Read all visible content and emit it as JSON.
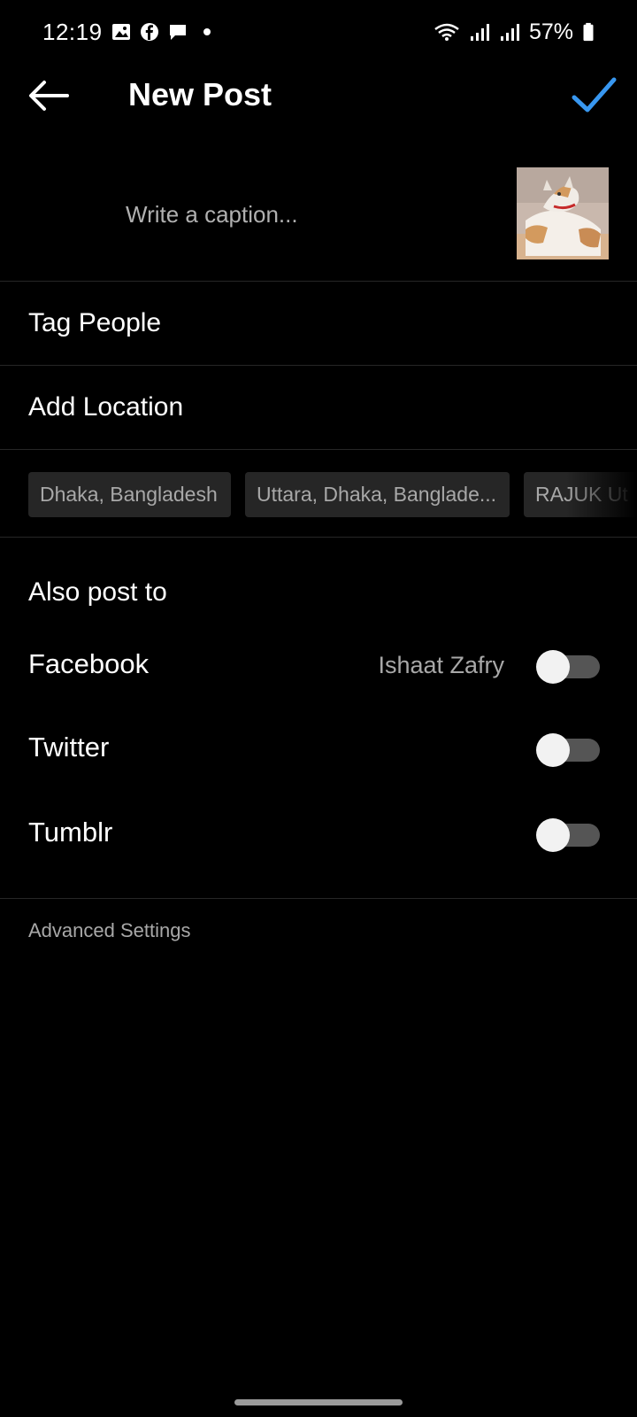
{
  "status_bar": {
    "time": "12:19",
    "battery": "57%"
  },
  "header": {
    "title": "New Post"
  },
  "caption": {
    "placeholder": "Write a caption..."
  },
  "menu": {
    "tag_people": "Tag People",
    "add_location": "Add Location"
  },
  "location_suggestions": [
    "Dhaka, Bangladesh",
    "Uttara, Dhaka, Banglade...",
    "RAJUK Ut"
  ],
  "also_post": {
    "title": "Also post to",
    "facebook": {
      "label": "Facebook",
      "account": "Ishaat Zafry",
      "enabled": false
    },
    "twitter": {
      "label": "Twitter",
      "enabled": false
    },
    "tumblr": {
      "label": "Tumblr",
      "enabled": false
    }
  },
  "advanced_settings": "Advanced Settings",
  "colors": {
    "background": "#000000",
    "accent": "#3897f0",
    "divider": "#262626",
    "secondary_text": "#a8a8a8"
  }
}
